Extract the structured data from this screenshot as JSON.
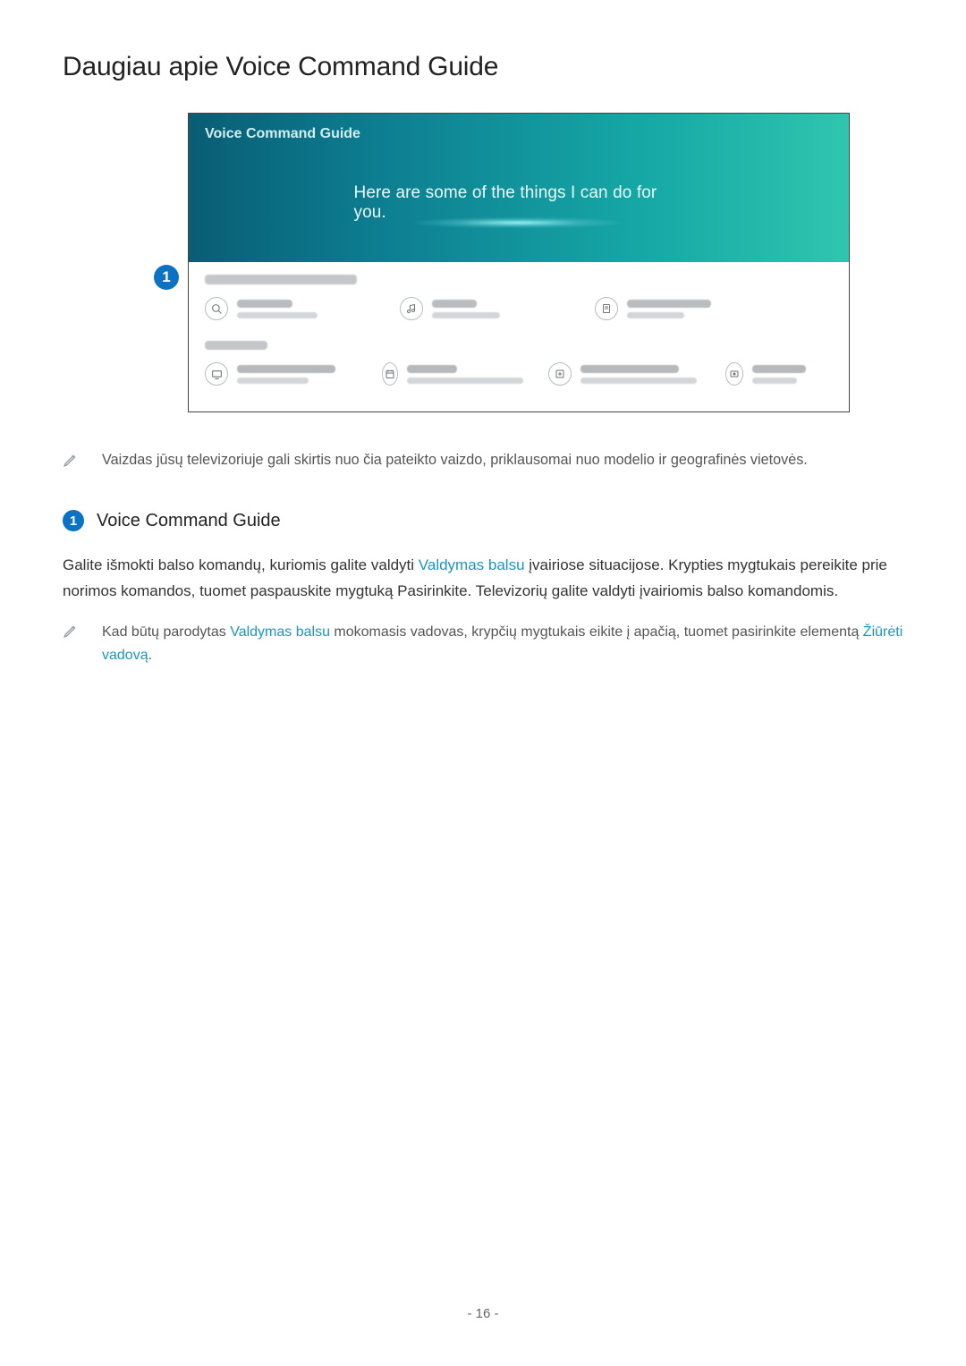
{
  "page": {
    "title": "Daugiau apie Voice Command Guide",
    "number": "- 16 -"
  },
  "tv": {
    "title": "Voice Command Guide",
    "headline": "Here are some of the things I can do for you."
  },
  "badge": {
    "one": "1"
  },
  "note1": "Vaizdas jūsų televizoriuje gali skirtis nuo čia pateikto vaizdo, priklausomai nuo modelio ir geografinės vietovės.",
  "subhead": {
    "num": "1",
    "text": "Voice Command Guide"
  },
  "paragraph": {
    "p1a": "Galite išmokti balso komandų, kuriomis galite valdyti ",
    "link1": "Valdymas balsu",
    "p1b": " įvairiose situacijose. Krypties mygtukais pereikite prie norimos komandos, tuomet paspauskite mygtuką Pasirinkite. Televizorių galite valdyti įvairiomis balso komandomis."
  },
  "note2": {
    "a": "Kad būtų parodytas ",
    "link1": "Valdymas balsu",
    "b": " mokomasis vadovas, krypčių mygtukais eikite į apačią, tuomet pasirinkite elementą ",
    "link2": "Žiūrėti vadovą",
    "c": "."
  }
}
